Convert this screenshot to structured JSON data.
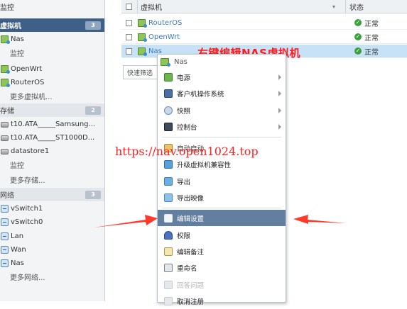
{
  "nav": {
    "top_label": "监控",
    "sections": [
      {
        "label": "虚拟机",
        "count": "3",
        "active": true
      },
      {
        "label": "存储",
        "count": "2",
        "active": false
      },
      {
        "label": "网络",
        "count": "3",
        "active": false
      }
    ],
    "vm_section": {
      "nas": "Nas",
      "nas_monitor": "监控",
      "openwrt": "OpenWrt",
      "routeros": "RouterOS",
      "more": "更多虚拟机..."
    },
    "storage_section": {
      "disk1": "t10.ATA_____Samsung...",
      "disk2": "t10.ATA_____ST1000D...",
      "datastore": "datastore1",
      "ds_monitor": "监控",
      "more": "更多存储..."
    },
    "network_section": {
      "vswitch1": "vSwitch1",
      "vswitch0": "vSwitch0",
      "lan": "Lan",
      "wan": "Wan",
      "nas": "Nas",
      "more": "更多网络..."
    }
  },
  "grid": {
    "col_name": "虚拟机",
    "col_status": "状态",
    "rows": [
      {
        "name": "RouterOS",
        "status": "正常"
      },
      {
        "name": "OpenWrt",
        "status": "正常"
      },
      {
        "name": "Nas",
        "status": "正常"
      }
    ],
    "filter_placeholder": "快速筛选"
  },
  "annotation": "右键编辑NAS虚拟机",
  "watermark": "https://nav.open1024.top",
  "context_menu": {
    "title": "Nas",
    "items": [
      {
        "label": "电源",
        "submenu": true
      },
      {
        "label": "客户机操作系统",
        "submenu": true
      },
      {
        "label": "快照",
        "submenu": true
      },
      {
        "label": "控制台",
        "submenu": true
      },
      {
        "label": "自动启动"
      },
      {
        "label": "升级虚拟机兼容性"
      },
      {
        "label": "导出"
      },
      {
        "label": "导出映像"
      },
      {
        "label": "编辑设置"
      },
      {
        "label": "权限"
      },
      {
        "label": "编辑备注"
      },
      {
        "label": "重命名"
      },
      {
        "label": "回答问题"
      },
      {
        "label": "取消注册"
      }
    ]
  },
  "colors": {
    "nav_active": "#3e5f86",
    "menu_highlight": "#637f9f",
    "annotation_red": "#ff1b1b",
    "status_ok": "#3aa23a",
    "link_blue": "#3b78b9"
  }
}
